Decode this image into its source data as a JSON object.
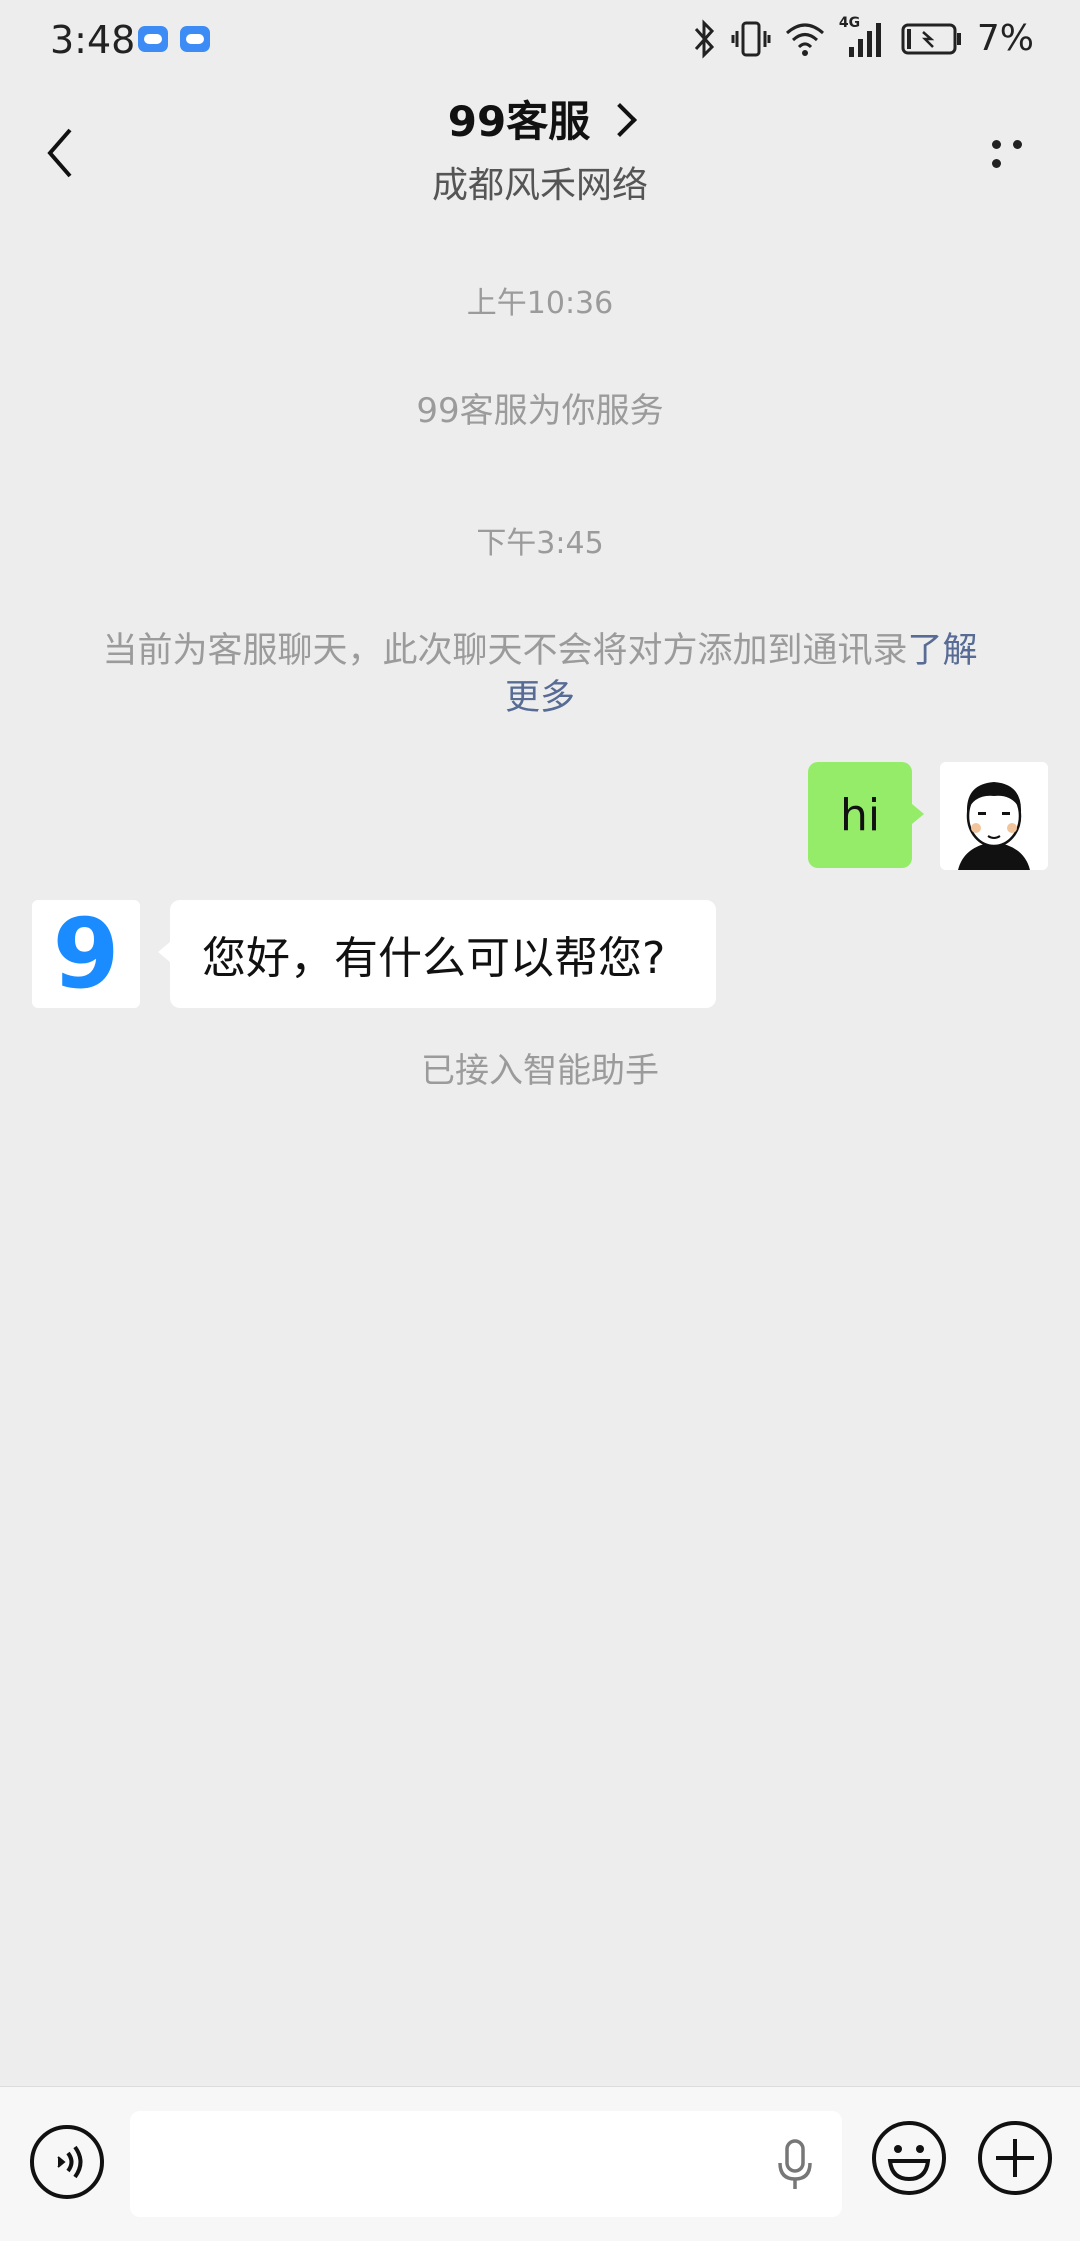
{
  "status_bar": {
    "time": "3:48",
    "battery": "7%",
    "network_badge": "4G"
  },
  "header": {
    "title": "99客服",
    "subtitle": "成都风禾网络"
  },
  "chat": {
    "timestamp_1": "上午10:36",
    "service_line": "99客服为你服务",
    "timestamp_2": "下午3:45",
    "notice_text": "当前为客服聊天，此次聊天不会将对方添加到通讯录",
    "notice_link": "了解更多",
    "outgoing_message": "hi",
    "incoming_message": "您好，有什么可以帮您?",
    "agent_avatar_glyph": "9",
    "assistant_notice": "已接入智能助手"
  },
  "colors": {
    "background": "#EDEDED",
    "outgoing_bubble": "#95EC69",
    "link": "#576B95",
    "brand_blue": "#1A8CFF"
  },
  "icons": [
    "back-icon",
    "more-icon",
    "voice-icon",
    "mic-icon",
    "emoji-icon",
    "plus-icon",
    "bluetooth-icon",
    "vibrate-icon",
    "wifi-icon",
    "signal-icon",
    "battery-icon",
    "cloud-icon"
  ]
}
